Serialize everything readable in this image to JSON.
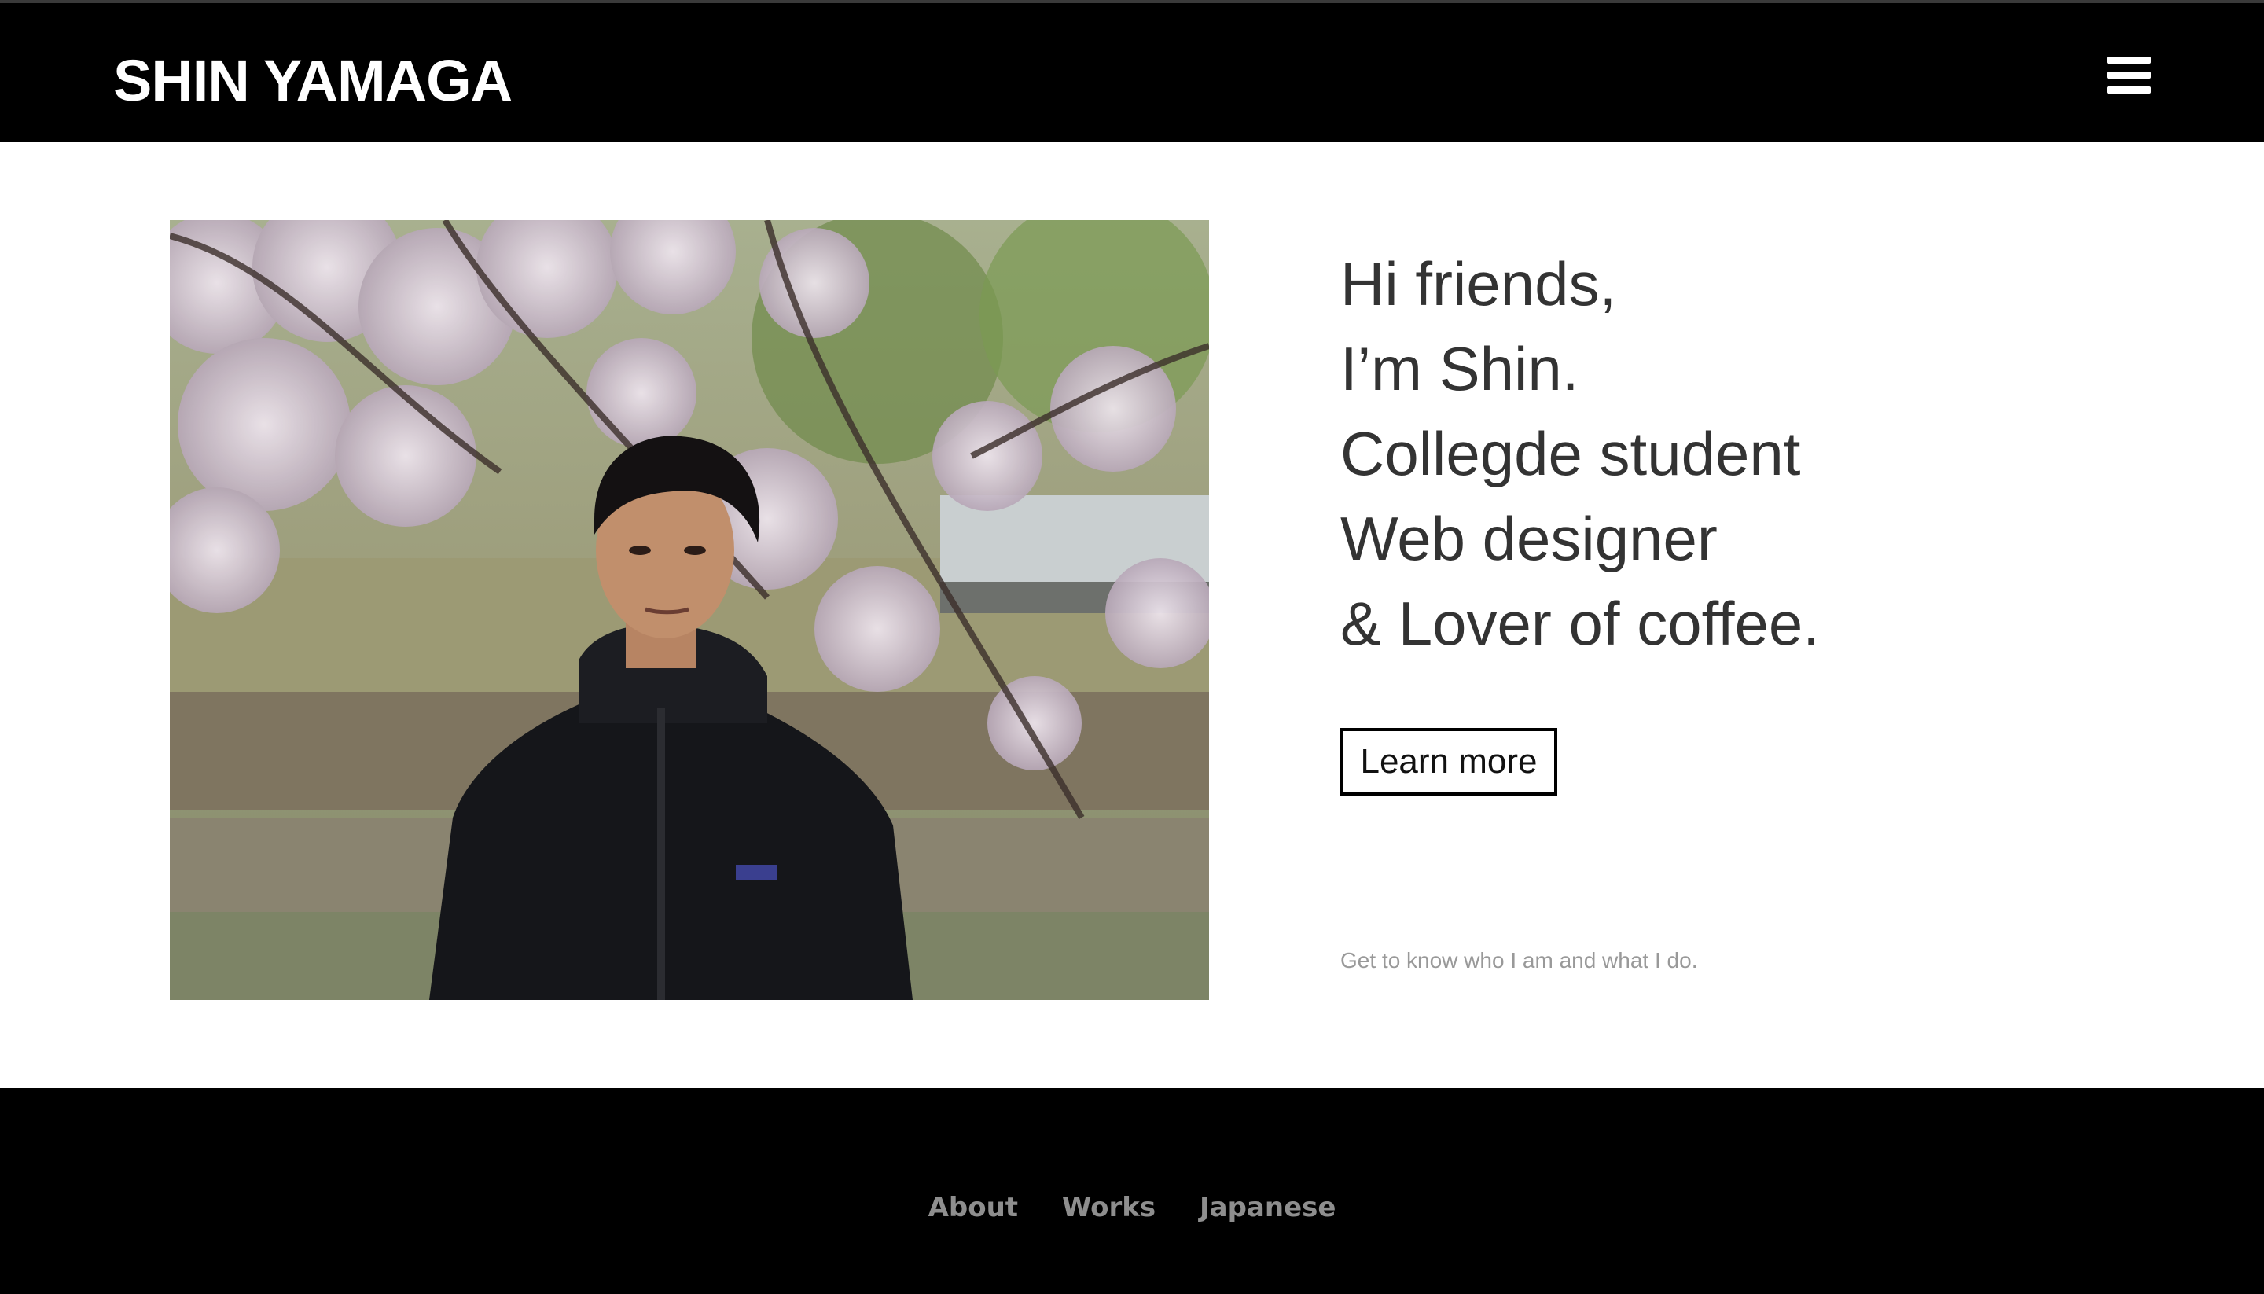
{
  "header": {
    "site_title": "SHIN YAMAGA",
    "menu_icon": "hamburger-menu-icon"
  },
  "hero": {
    "photo_description_icon": "portrait-photo",
    "intro_lines": [
      "Hi friends,",
      "I’m Shin.",
      "Collegde student",
      "Web designer",
      "& Lover of coffee."
    ],
    "learn_more_label": "Learn more",
    "learn_more_caption": "Get to know who I am and what I do."
  },
  "footer": {
    "links": [
      "About",
      "Works",
      "Japanese"
    ]
  },
  "colors": {
    "header_bg": "#000000",
    "footer_bg": "#000000",
    "text_dark": "#333333",
    "caption_gray": "#999999",
    "footer_link_gray": "#8e8e8e"
  }
}
